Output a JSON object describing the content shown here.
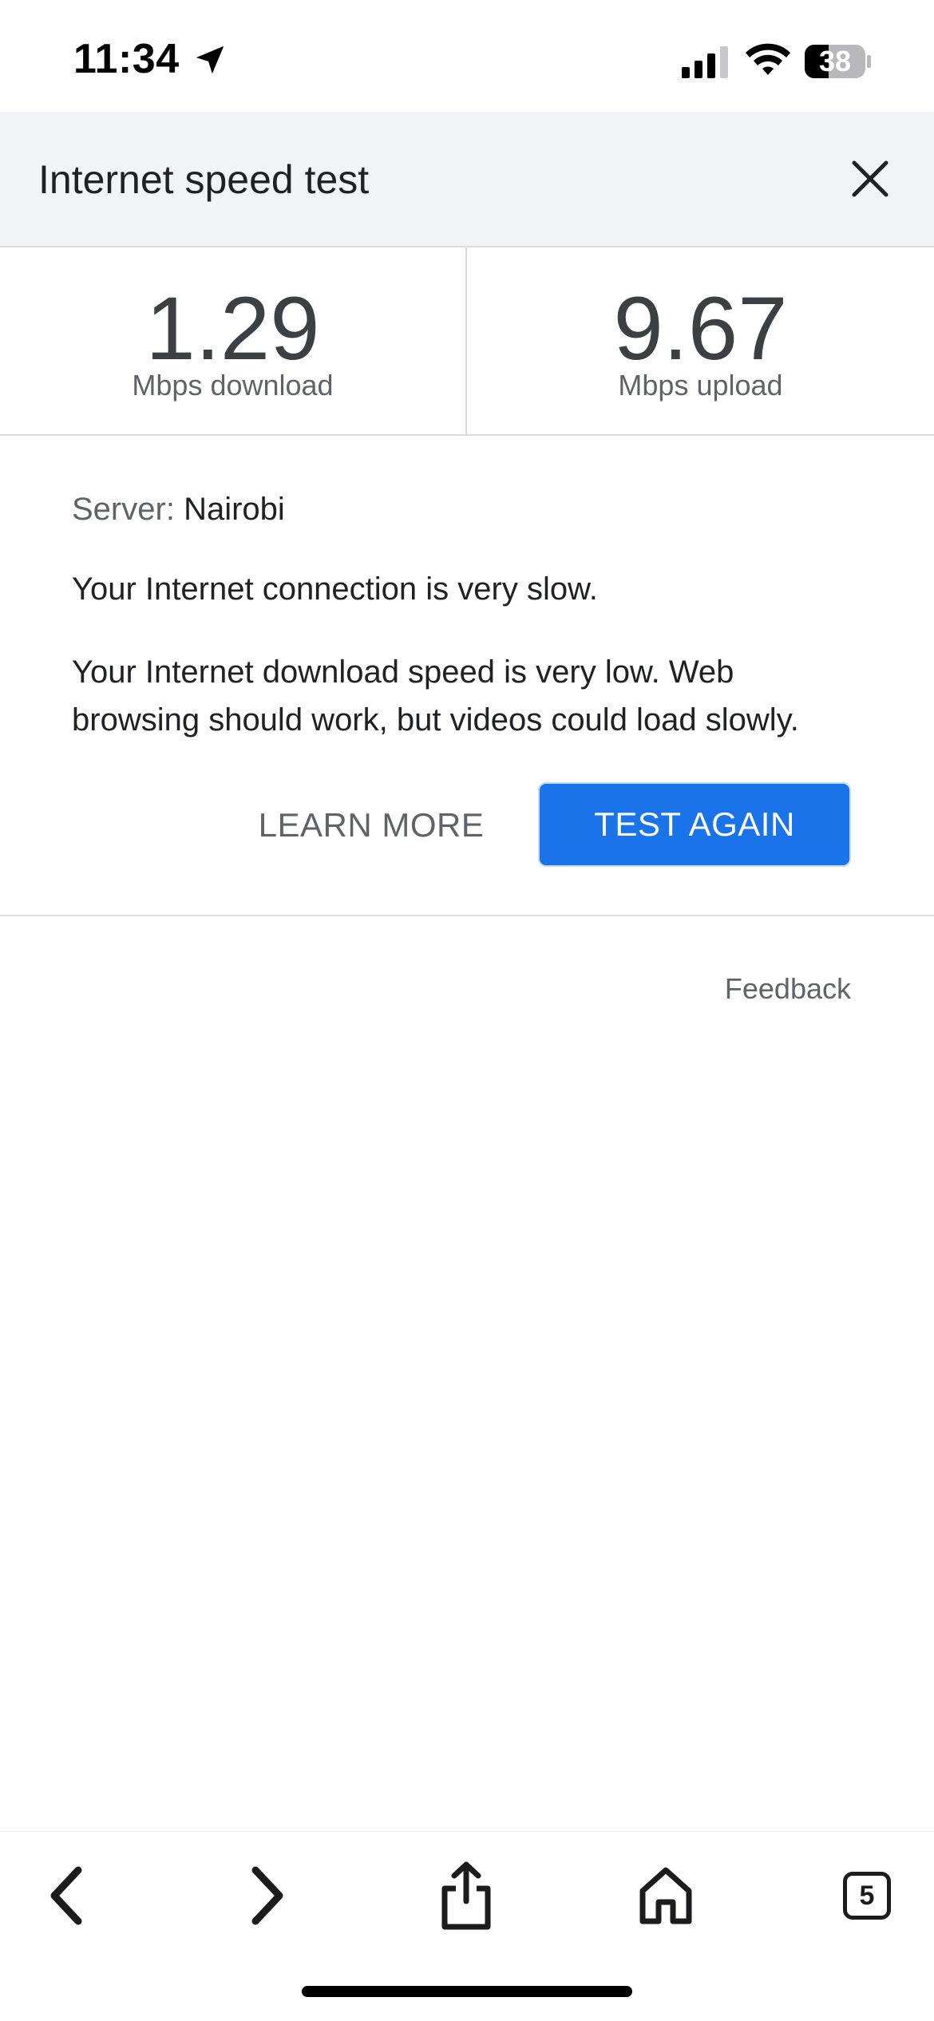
{
  "status_bar": {
    "time": "11:34",
    "battery": "38",
    "icons": [
      "location-arrow-icon",
      "signal-icon",
      "wifi-icon",
      "battery-icon"
    ]
  },
  "header": {
    "title": "Internet speed test",
    "close_icon": "close-icon"
  },
  "results": {
    "download": {
      "value": "1.29",
      "label": "Mbps download"
    },
    "upload": {
      "value": "9.67",
      "label": "Mbps upload"
    }
  },
  "info": {
    "server_prefix": "Server:",
    "server_name": "Nairobi",
    "status_message": "Your Internet connection is very slow.",
    "detail_message": "Your Internet download speed is very low. Web browsing should work, but videos could load slowly."
  },
  "actions": {
    "learn_more": "LEARN MORE",
    "test_again": "TEST AGAIN"
  },
  "feedback": "Feedback",
  "toolbar": {
    "tabs_count": "5",
    "icons": [
      "back-icon",
      "forward-icon",
      "share-icon",
      "home-icon",
      "tabs-icon"
    ]
  },
  "colors": {
    "accent": "#1a73e8",
    "header_bg": "#f1f3f4",
    "divider": "#dadce0"
  }
}
